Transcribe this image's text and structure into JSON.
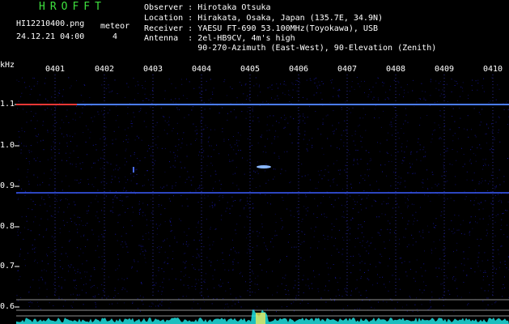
{
  "header": {
    "app_title": "HROFFT",
    "file_name": "HI12210400.png",
    "meteor_label": "meteor",
    "datetime": "24.12.21 04:00",
    "meteor_count": "4"
  },
  "station": {
    "observer": "Observer : Hirotaka Otsuka",
    "location": "Location : Hirakata, Osaka, Japan (135.7E, 34.9N)",
    "receiver": "Receiver : YAESU FT-690 53.100MHz(Toyokawa), USB",
    "antenna": "Antenna  : 2el-HB9CV, 4m's high",
    "antenna_detail": "           90-270-Azimuth (East-West), 90-Elevation (Zenith)"
  },
  "axes": {
    "unit": "kHz",
    "time_ticks": [
      "0401",
      "0402",
      "0403",
      "0404",
      "0405",
      "0406",
      "0407",
      "0408",
      "0409",
      "0410"
    ],
    "freq_ticks": [
      "1.1",
      "1.0",
      "0.9",
      "0.8",
      "0.7",
      "0.6"
    ]
  },
  "colors": {
    "title_green": "#3ee03e",
    "background": "#000000",
    "noise_blue": "#1a1a8c",
    "signal_line": "#4a7cff",
    "signal_hot": "#ff3020",
    "baseline_cyan": "#20e0e0"
  }
}
